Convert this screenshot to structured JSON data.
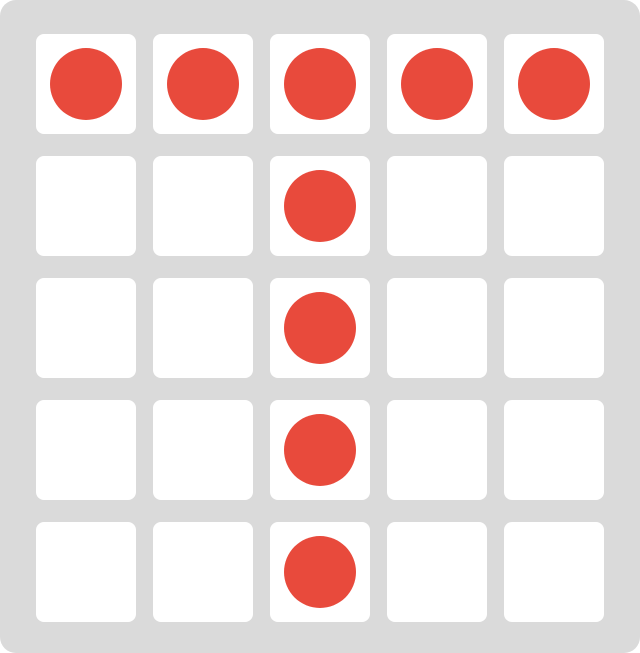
{
  "board": {
    "rows": 5,
    "cols": 5,
    "colors": {
      "background": "#dadada",
      "cell": "#ffffff",
      "piece": "#e84a3c"
    },
    "cells": [
      [
        1,
        1,
        1,
        1,
        1
      ],
      [
        0,
        0,
        1,
        0,
        0
      ],
      [
        0,
        0,
        1,
        0,
        0
      ],
      [
        0,
        0,
        1,
        0,
        0
      ],
      [
        0,
        0,
        1,
        0,
        0
      ]
    ]
  }
}
